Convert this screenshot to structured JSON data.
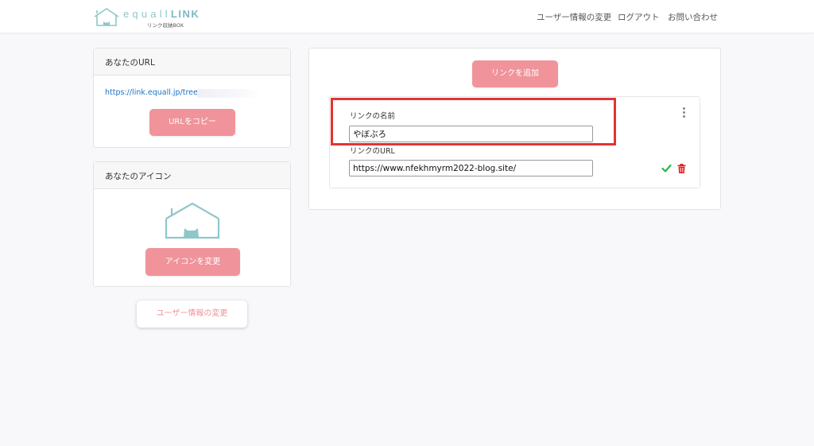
{
  "header": {
    "logo_title_light": "equall",
    "logo_title_bold": "LINK",
    "logo_subtitle": "リンク収納BOX",
    "nav": {
      "profile": "ユーザー情報の変更",
      "logout": "ログアウト",
      "contact": "お問い合わせ"
    }
  },
  "url_card": {
    "title": "あなたのURL",
    "url": "https://link.equall.jp/tree/",
    "copy_button": "URLをコピー"
  },
  "icon_card": {
    "title": "あなたのアイコン",
    "change_button": "アイコンを変更"
  },
  "user_info_button": "ユーザー情報の変更",
  "links": {
    "add_button": "リンクを追加",
    "item": {
      "name_label": "リンクの名前",
      "name_value": "やぼぶろ",
      "url_label": "リンクのURL",
      "url_value": "https://www.nfekhmyrm2022-blog.site/"
    }
  },
  "colors": {
    "accent_pink": "#f0939a",
    "brand_teal": "#8fc7c8",
    "highlight_red": "#e23434",
    "check_green": "#2bb34b",
    "delete_red": "#e0211f"
  }
}
